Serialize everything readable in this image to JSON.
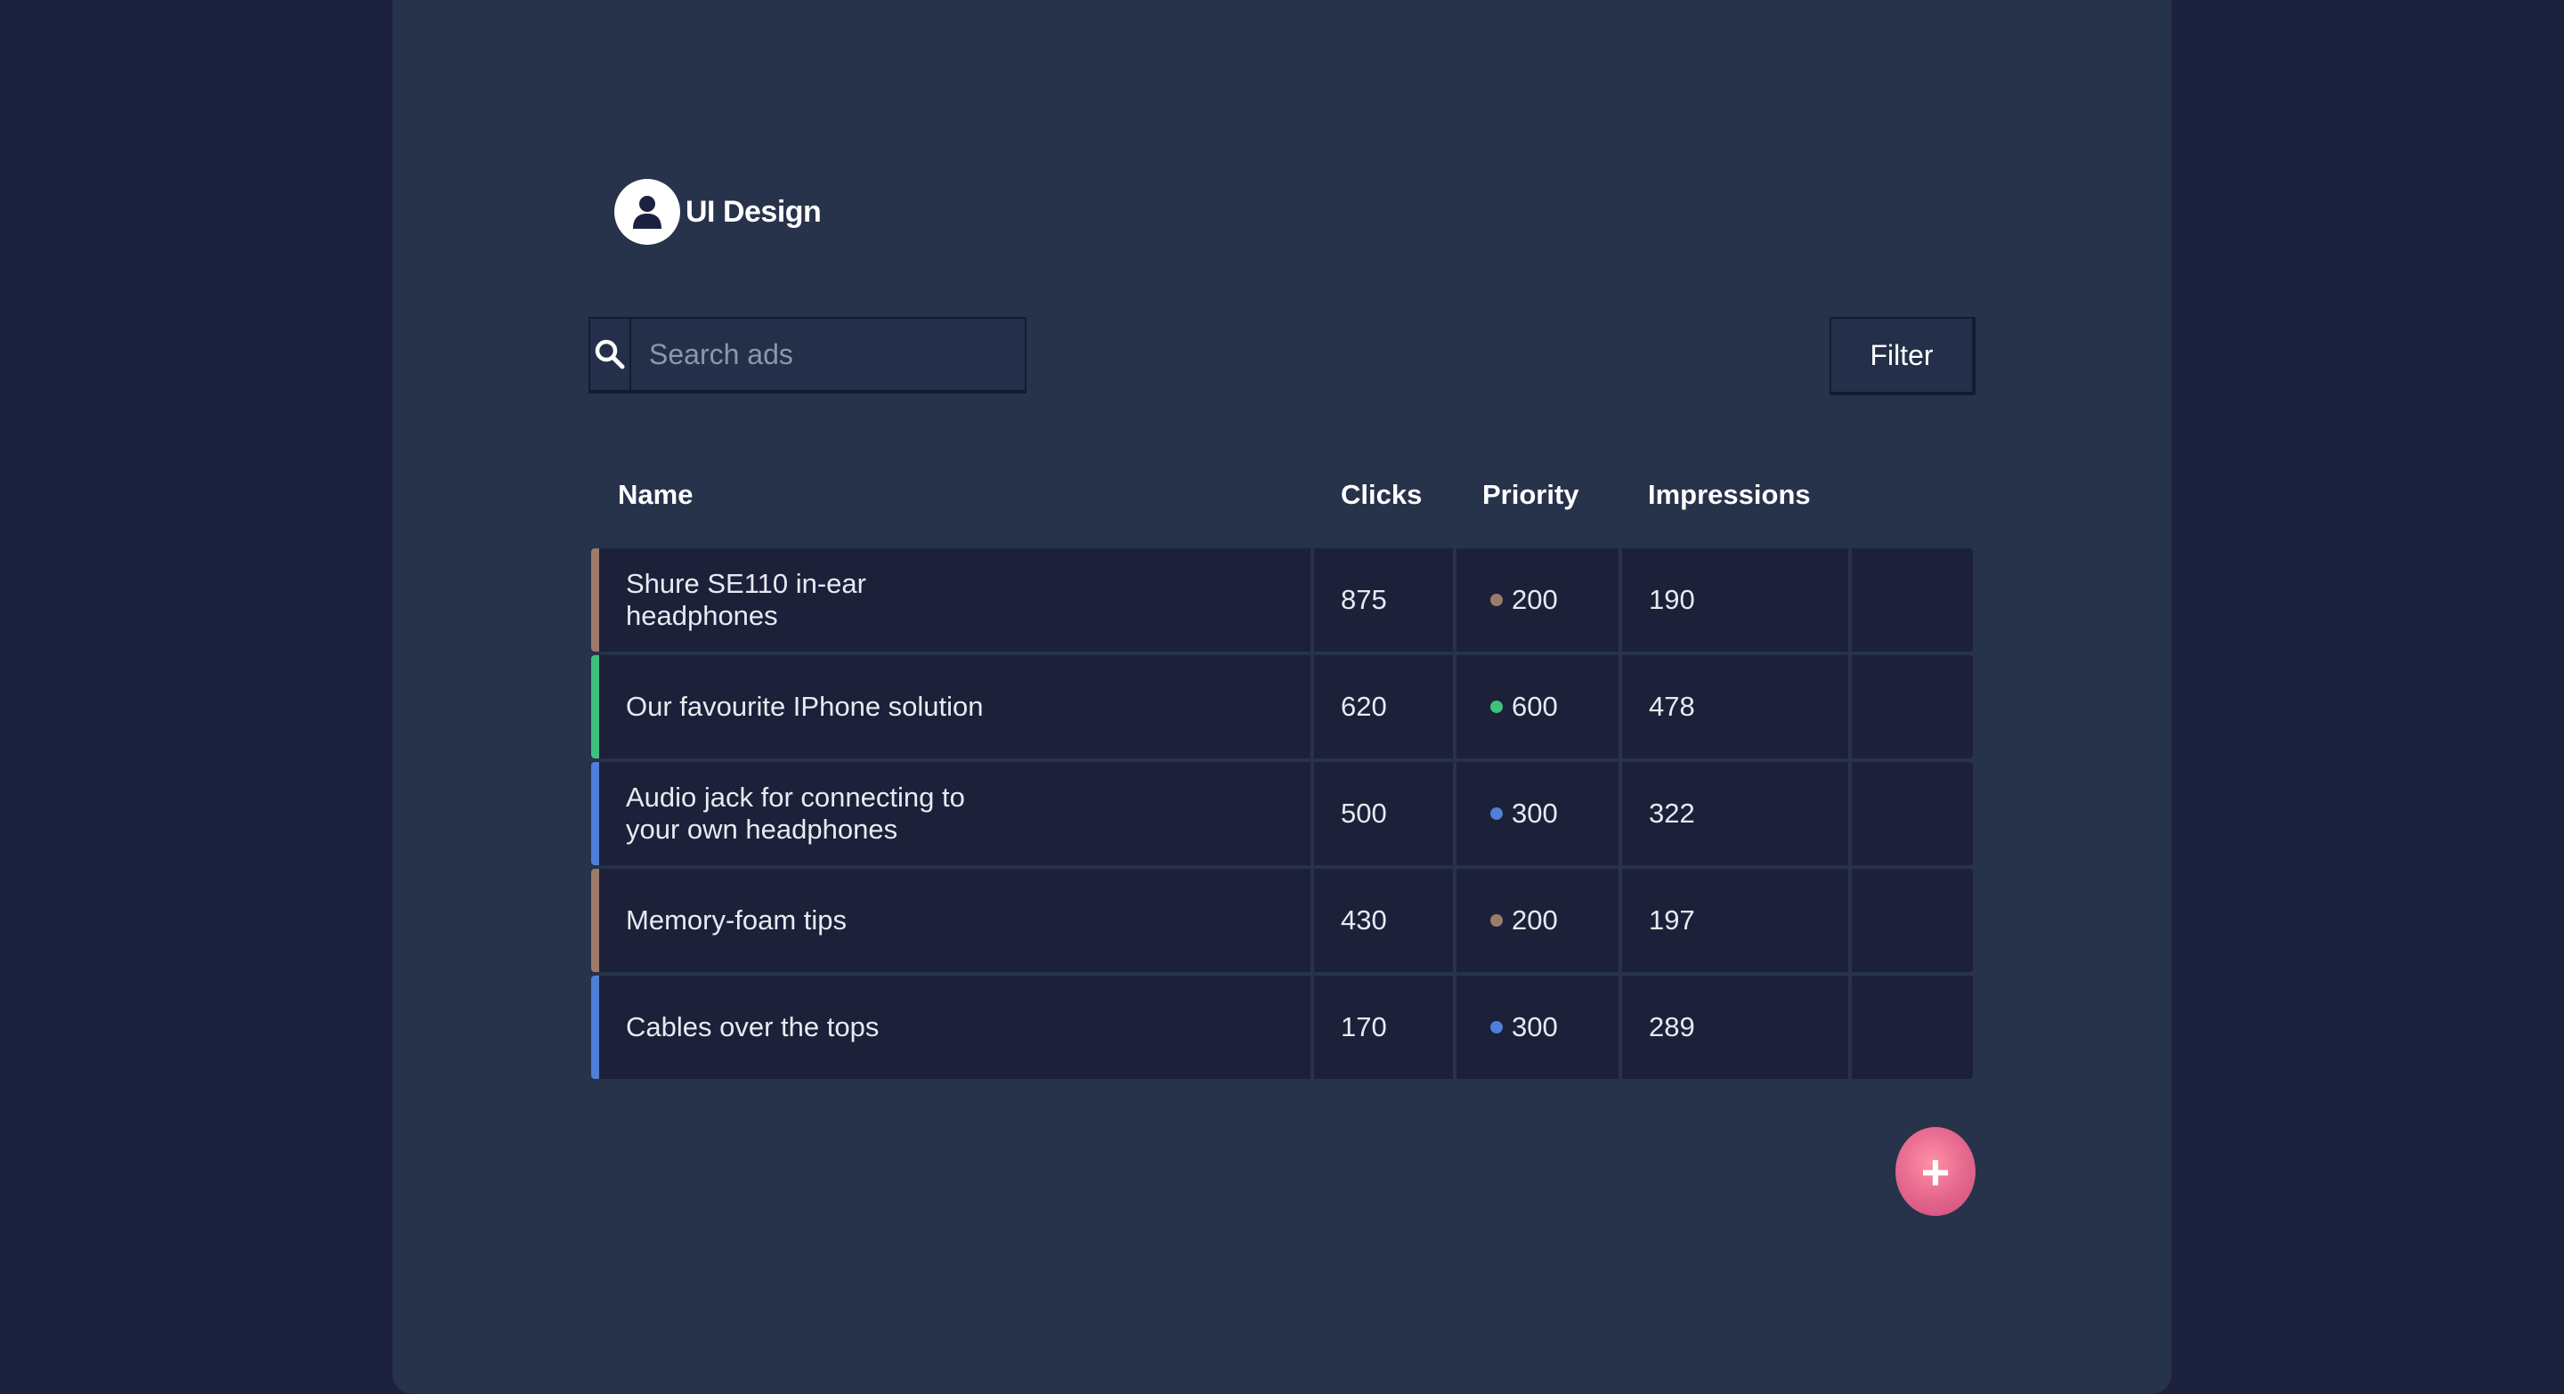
{
  "header": {
    "title": "UI Design",
    "avatar_icon": "user-icon"
  },
  "search": {
    "placeholder": "Search ads",
    "value": "",
    "icon": "search-icon"
  },
  "toolbar": {
    "filter_label": "Filter"
  },
  "table": {
    "columns": [
      "Name",
      "Clicks",
      "Priority",
      "Impressions"
    ],
    "rows": [
      {
        "name": "Shure SE110 in-ear headphones",
        "clicks": "875",
        "priority": "200",
        "impressions": "190",
        "color": "#9c7b6a"
      },
      {
        "name": "Our favourite IPhone solution",
        "clicks": "620",
        "priority": "600",
        "impressions": "478",
        "color": "#3fc07d"
      },
      {
        "name": "Audio jack for connecting to your own headphones",
        "clicks": "500",
        "priority": "300",
        "impressions": "322",
        "color": "#4f7fd8"
      },
      {
        "name": "Memory-foam tips",
        "clicks": "430",
        "priority": "200",
        "impressions": "197",
        "color": "#9c7b6a"
      },
      {
        "name": "Cables over the tops",
        "clicks": "170",
        "priority": "300",
        "impressions": "289",
        "color": "#4f7fd8"
      }
    ]
  },
  "fab": {
    "label": "+",
    "icon": "plus-icon"
  },
  "colors": {
    "background": "#1d2140",
    "panel": "#27324b",
    "row": "#1c2039",
    "accent": "#e3658c"
  }
}
